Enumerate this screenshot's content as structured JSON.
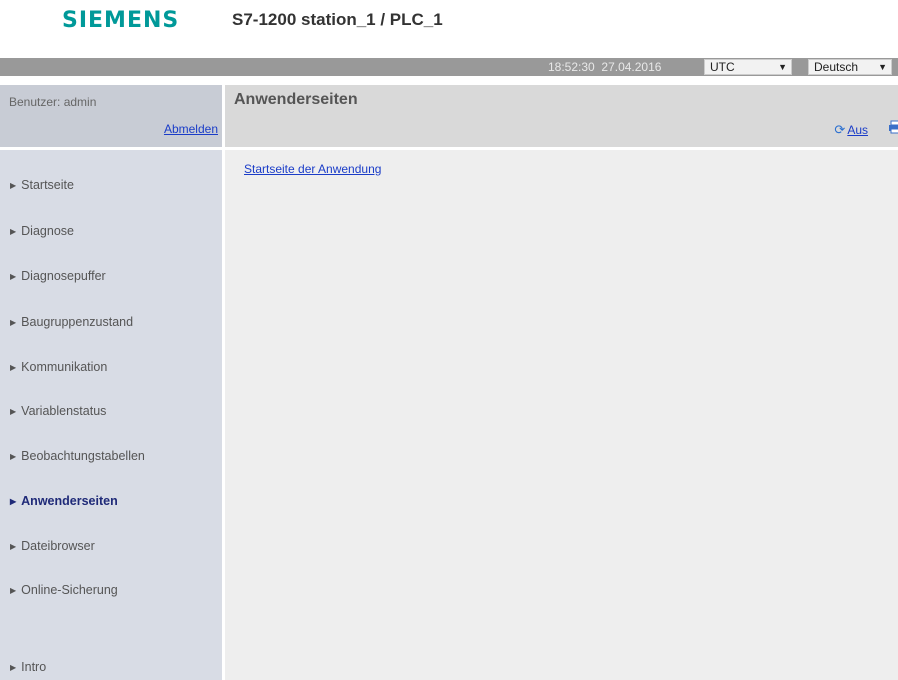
{
  "header": {
    "logo": "SIEMENS",
    "station": "S7-1200 station_1 / PLC_1"
  },
  "topbar": {
    "time": "18:52:30",
    "date": "27.04.2016",
    "timezone": "UTC",
    "language": "Deutsch"
  },
  "sidebar": {
    "user_label": "Benutzer: admin",
    "logout_label": "Abmelden",
    "items": [
      {
        "label": "Startseite"
      },
      {
        "label": "Diagnose"
      },
      {
        "label": "Diagnosepuffer"
      },
      {
        "label": "Baugruppenzustand"
      },
      {
        "label": "Kommunikation"
      },
      {
        "label": "Variablenstatus"
      },
      {
        "label": "Beobachtungstabellen"
      },
      {
        "label": "Anwenderseiten"
      },
      {
        "label": "Dateibrowser"
      },
      {
        "label": "Online-Sicherung"
      },
      {
        "label": "Intro"
      }
    ],
    "active_item": "Anwenderseiten"
  },
  "main": {
    "title": "Anwenderseiten",
    "refresh_label": "Aus",
    "app_link": "Startseite der Anwendung"
  },
  "icons": {
    "refresh": "refresh-icon",
    "print": "print-icon",
    "nav_arrow": "triangle-right-icon",
    "dropdown": "dropdown-arrow-icon"
  },
  "colors": {
    "brand": "#009999",
    "link": "#1a3cc8",
    "active_nav": "#1f2a78"
  }
}
